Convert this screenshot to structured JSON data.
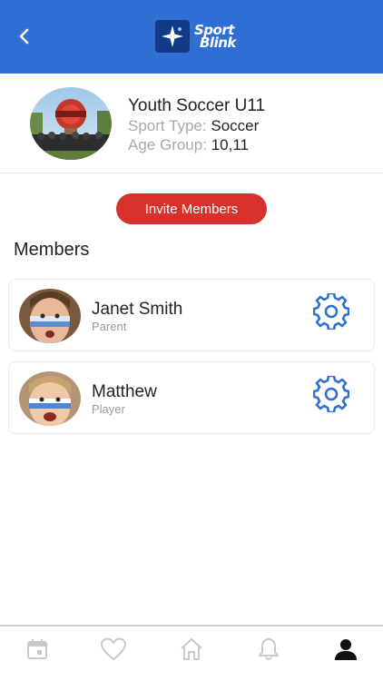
{
  "header": {
    "back_icon": "chevron-left-icon",
    "logo_line1": "Sport",
    "logo_line2": "Blink",
    "color": "#2f6fd3"
  },
  "team": {
    "name": "Youth Soccer U11",
    "sport_type_label": "Sport Type:",
    "sport_type_value": "Soccer",
    "age_group_label": "Age Group:",
    "age_group_value": "10,11"
  },
  "invite_button": {
    "label": "Invite Members",
    "color": "#d6312c"
  },
  "members": {
    "title": "Members",
    "items": [
      {
        "name": "Janet Smith",
        "role": "Parent",
        "action_icon": "gear-icon"
      },
      {
        "name": "Matthew",
        "role": "Player",
        "action_icon": "gear-icon"
      }
    ]
  },
  "tabbar": {
    "items": [
      {
        "icon": "calendar-icon",
        "active": false
      },
      {
        "icon": "heart-icon",
        "active": false
      },
      {
        "icon": "home-icon",
        "active": false
      },
      {
        "icon": "bell-icon",
        "active": false
      },
      {
        "icon": "profile-icon",
        "active": true
      }
    ]
  }
}
